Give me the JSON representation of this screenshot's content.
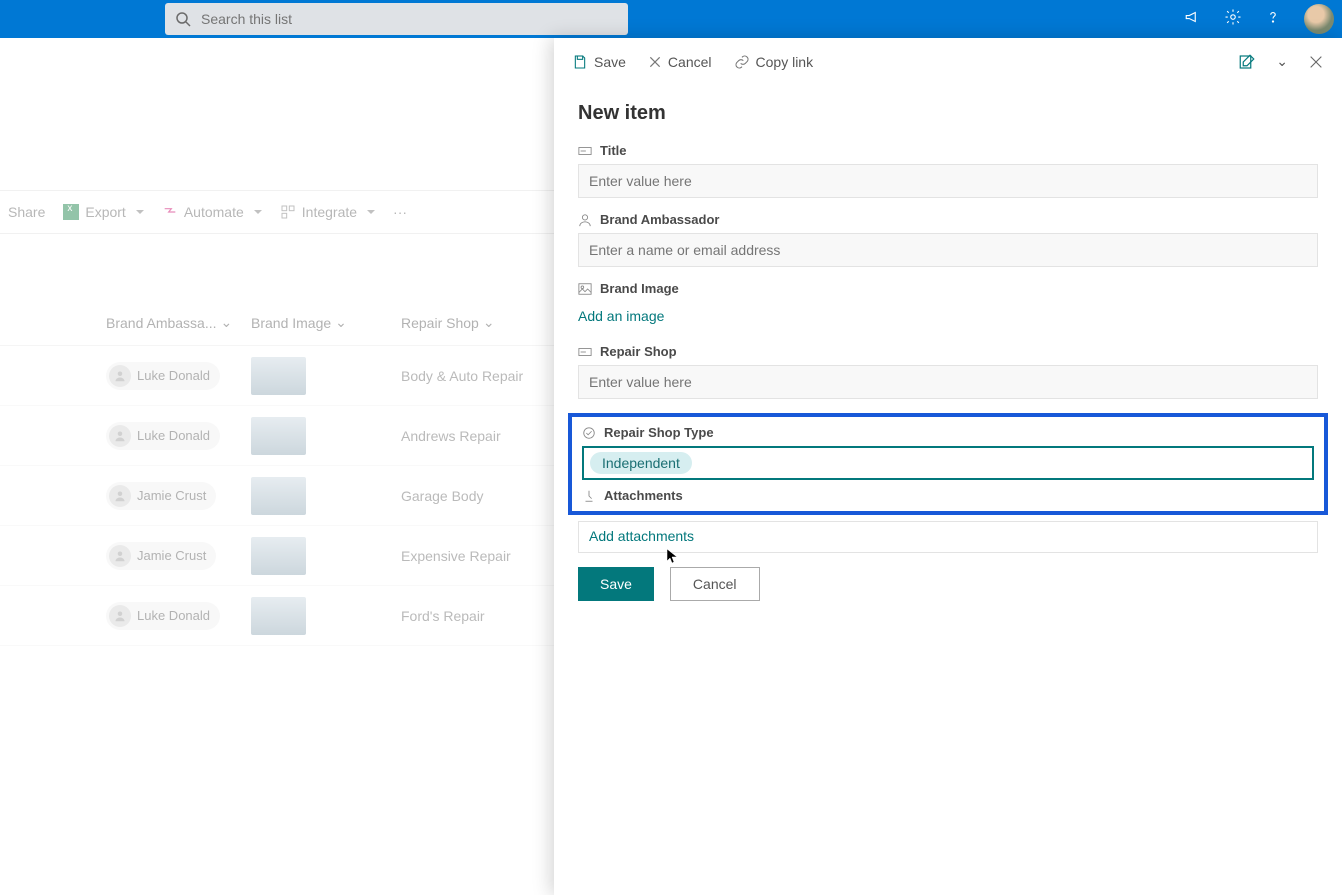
{
  "topbar": {
    "search_placeholder": "Search this list"
  },
  "cmdbar": {
    "share": "Share",
    "export": "Export",
    "automate": "Automate",
    "integrate": "Integrate"
  },
  "columns": {
    "ambassador": "Brand Ambassa...",
    "image": "Brand Image",
    "shop": "Repair Shop"
  },
  "rows": [
    {
      "ambassador": "Luke Donald",
      "shop": "Body & Auto Repair"
    },
    {
      "ambassador": "Luke Donald",
      "shop": "Andrews Repair"
    },
    {
      "ambassador": "Jamie Crust",
      "shop": "Garage Body"
    },
    {
      "ambassador": "Jamie Crust",
      "shop": "Expensive Repair"
    },
    {
      "ambassador": "Luke Donald",
      "shop": "Ford's Repair"
    }
  ],
  "panel": {
    "toolbar": {
      "save": "Save",
      "cancel": "Cancel",
      "copylink": "Copy link"
    },
    "title": "New item",
    "fields": {
      "title_label": "Title",
      "title_placeholder": "Enter value here",
      "ambassador_label": "Brand Ambassador",
      "ambassador_placeholder": "Enter a name or email address",
      "image_label": "Brand Image",
      "image_action": "Add an image",
      "repairshop_label": "Repair Shop",
      "repairshop_placeholder": "Enter value here",
      "repairtype_label": "Repair Shop Type",
      "repairtype_value": "Independent",
      "attachments_label": "Attachments",
      "attachments_action": "Add attachments"
    },
    "buttons": {
      "save": "Save",
      "cancel": "Cancel"
    }
  }
}
